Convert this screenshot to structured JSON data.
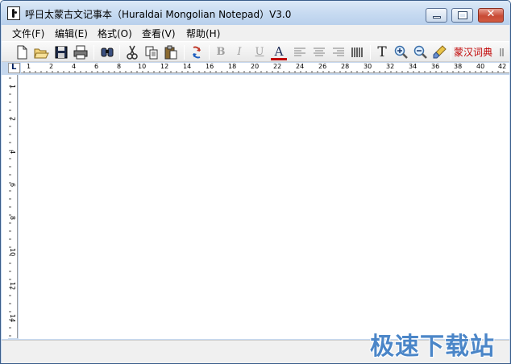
{
  "window": {
    "title": "呼日太蒙古文记事本（Huraldai Mongolian Notepad）V3.0",
    "close_glyph": "✕"
  },
  "menu": {
    "items": [
      "文件(F)",
      "编辑(E)",
      "格式(O)",
      "查看(V)",
      "帮助(H)"
    ]
  },
  "toolbar": {
    "icons": [
      "new-document-icon",
      "open-folder-icon",
      "save-icon",
      "print-icon",
      "find-icon",
      "cut-icon",
      "copy-icon",
      "paste-icon",
      "redo-icon",
      "bold-icon",
      "italic-icon",
      "underline-icon",
      "font-color-icon",
      "align-left-icon",
      "align-center-icon",
      "align-right-icon",
      "column-layout-icon",
      "text-font-icon",
      "zoom-in-icon",
      "zoom-out-icon",
      "clear-format-icon"
    ],
    "bold_glyph": "B",
    "italic_glyph": "I",
    "underline_glyph": "U",
    "font_color_glyph": "A",
    "text_glyph": "T",
    "dictionary_label": "蒙汉词典",
    "accent_color": "#c00000"
  },
  "ruler": {
    "corner_label": "L",
    "horizontal_numbers": [
      "1",
      "2",
      "4",
      "6",
      "8",
      "10",
      "12",
      "14",
      "16",
      "18",
      "20",
      "22",
      "24",
      "26",
      "28",
      "30",
      "32",
      "34",
      "36",
      "38",
      "40",
      "42"
    ],
    "vertical_numbers": [
      "1",
      "2",
      "4",
      "6",
      "8",
      "10",
      "12",
      "14"
    ]
  },
  "watermark": {
    "text": "极速下载站",
    "color": "#4b86c8"
  }
}
